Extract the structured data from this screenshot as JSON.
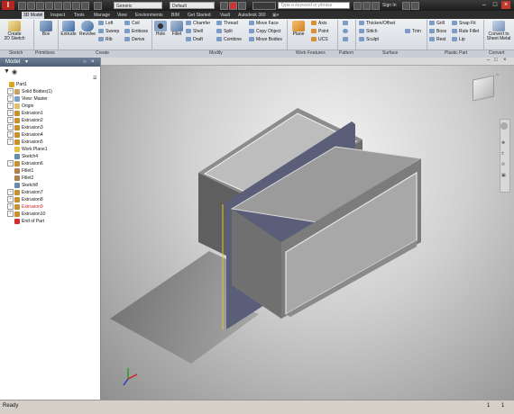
{
  "titlebar": {
    "logo": "I",
    "material_combo": "Generic",
    "appearance_combo": "Default",
    "search_placeholder": "Type a keyword or phrase",
    "sign_in": "Sign In"
  },
  "ribbon_tabs": [
    "3D Model",
    "Inspect",
    "Tools",
    "Manage",
    "View",
    "Environments",
    "BIM",
    "Get Started",
    "Vault",
    "Autodesk 360"
  ],
  "ribbon": {
    "sketch": {
      "create_2d_sketch": "Create\n2D Sketch",
      "panel": "Sketch"
    },
    "primitives": {
      "box": "Box",
      "panel": "Primitives"
    },
    "create": {
      "extrude": "Extrude",
      "revolve": "Revolve",
      "loft": "Loft",
      "sweep": "Sweep",
      "rib": "Rib",
      "coil": "Coil",
      "emboss": "Emboss",
      "derive": "Derive",
      "panel": "Create"
    },
    "modify": {
      "hole": "Hole",
      "fillet": "Fillet",
      "chamfer": "Chamfer",
      "shell": "Shell",
      "draft": "Draft",
      "thread": "Thread",
      "split": "Split",
      "combine": "Combine",
      "move_face": "Move Face",
      "copy_object": "Copy Object",
      "move_bodies": "Move Bodies",
      "panel": "Modify"
    },
    "work_features": {
      "plane": "Plane",
      "axis": "Axis",
      "point": "Point",
      "ucs": "UCS",
      "panel": "Work Features"
    },
    "pattern": {
      "panel": "Pattern"
    },
    "surface": {
      "thicken_offset": "Thicken/Offset",
      "stitch": "Stitch",
      "sculpt": "Sculpt",
      "trim": "Trim",
      "panel": "Surface"
    },
    "plastic_part": {
      "grill": "Grill",
      "boss": "Boss",
      "rest": "Rest",
      "snap_fit": "Snap Fit",
      "rule_fillet": "Rule Fillet",
      "lip": "Lip",
      "panel": "Plastic Part"
    },
    "convert": {
      "convert_to_sheet_metal": "Convert to\nSheet Metal",
      "panel": "Convert"
    }
  },
  "browser": {
    "title": "Model",
    "items": [
      {
        "label": "Part1",
        "level": 0,
        "exp": "",
        "color": "#d9a520"
      },
      {
        "label": "Solid Bodies(1)",
        "level": 1,
        "exp": "+",
        "color": "#c8a060"
      },
      {
        "label": "View: Master",
        "level": 1,
        "exp": "+",
        "color": "#7aa0c8"
      },
      {
        "label": "Origin",
        "level": 1,
        "exp": "+",
        "color": "#e0c070"
      },
      {
        "label": "Extrusion1",
        "level": 1,
        "exp": "+",
        "color": "#c89030"
      },
      {
        "label": "Extrusion2",
        "level": 1,
        "exp": "+",
        "color": "#c89030"
      },
      {
        "label": "Extrusion3",
        "level": 1,
        "exp": "+",
        "color": "#c89030"
      },
      {
        "label": "Extrusion4",
        "level": 1,
        "exp": "+",
        "color": "#c89030"
      },
      {
        "label": "Extrusion5",
        "level": 1,
        "exp": "+",
        "color": "#c89030"
      },
      {
        "label": "Work Plane1",
        "level": 1,
        "exp": "",
        "color": "#e8c040"
      },
      {
        "label": "Sketch4",
        "level": 1,
        "exp": "",
        "color": "#6a8ab0"
      },
      {
        "label": "Extrusion6",
        "level": 1,
        "exp": "+",
        "color": "#c89030"
      },
      {
        "label": "Fillet1",
        "level": 1,
        "exp": "",
        "color": "#b08050"
      },
      {
        "label": "Fillet2",
        "level": 1,
        "exp": "",
        "color": "#b08050"
      },
      {
        "label": "Sketch8",
        "level": 1,
        "exp": "",
        "color": "#6a8ab0"
      },
      {
        "label": "Extrusion7",
        "level": 1,
        "exp": "+",
        "color": "#c89030"
      },
      {
        "label": "Extrusion8",
        "level": 1,
        "exp": "+",
        "color": "#c89030"
      },
      {
        "label": "Extrusion9",
        "level": 1,
        "exp": "+",
        "color": "#c89030",
        "highlight": true
      },
      {
        "label": "Extrusion10",
        "level": 1,
        "exp": "+",
        "color": "#c89030"
      },
      {
        "label": "End of Part",
        "level": 1,
        "exp": "",
        "color": "#d03030"
      }
    ]
  },
  "status": {
    "text": "Ready",
    "count1": "1",
    "count2": "1"
  },
  "colors": {
    "highlight_text": "#d02020",
    "viewport_mid": "#cfcfcf",
    "ribbon_top": "#eef0f3"
  }
}
